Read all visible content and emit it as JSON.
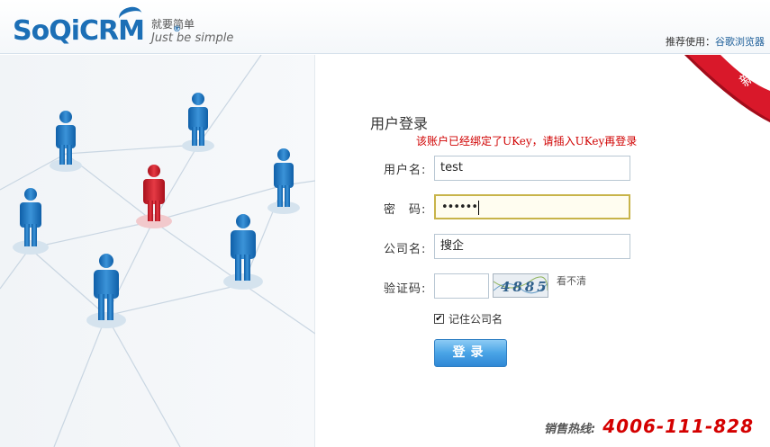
{
  "header": {
    "logo_text": "SoQiCRM",
    "logo_reg": "®",
    "slogan_cn": "就要简单",
    "slogan_en": "Just be simple",
    "browser_tip_prefix": "推荐使用：",
    "browser_tip_link": "谷歌浏览器"
  },
  "ribbon": {
    "text": "新版",
    "color": "#d9182a"
  },
  "login": {
    "title": "用户登录",
    "error": "该账户已经绑定了UKey，请插入UKey再登录",
    "username_label": "用户名:",
    "username_value": "test",
    "password_label": "密　码:",
    "password_mask": "••••••",
    "company_label": "公司名:",
    "company_value": "搜企",
    "captcha_label": "验证码:",
    "captcha_value": "",
    "captcha_text": "4885",
    "captcha_refresh": "看不清",
    "remember_label": "记住公司名",
    "remember_checked": "✔",
    "submit_label": "登录"
  },
  "footer": {
    "hotline_label": "销售热线:",
    "hotline_number": "4006-111-828"
  },
  "colors": {
    "brand_blue": "#1c6fb6",
    "error_red": "#d00000",
    "hotline_red": "#d40000",
    "button_blue": "#2f88d6"
  }
}
